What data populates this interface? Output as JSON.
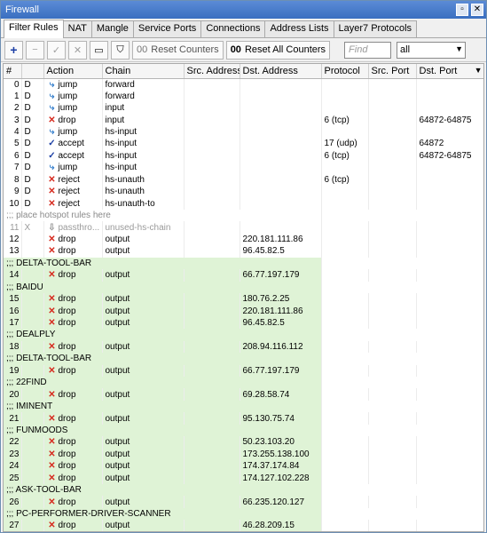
{
  "window": {
    "title": "Firewall"
  },
  "tabs": [
    "Filter Rules",
    "NAT",
    "Mangle",
    "Service Ports",
    "Connections",
    "Address Lists",
    "Layer7 Protocols"
  ],
  "toolbar": {
    "reset_counters": "Reset Counters",
    "reset_all_counters": "Reset All Counters",
    "find_placeholder": "Find",
    "filter_value": "all"
  },
  "columns": [
    "#",
    "",
    "Action",
    "Chain",
    "Src. Address",
    "Dst. Address",
    "Protocol",
    "Src. Port",
    "Dst. Port"
  ],
  "rows": [
    {
      "type": "rule",
      "n": "0",
      "f": "D",
      "a": "jump",
      "c": "forward",
      "src": "",
      "dst": "",
      "p": "",
      "sp": "",
      "dp": ""
    },
    {
      "type": "rule",
      "n": "1",
      "f": "D",
      "a": "jump",
      "c": "forward",
      "src": "",
      "dst": "",
      "p": "",
      "sp": "",
      "dp": ""
    },
    {
      "type": "rule",
      "n": "2",
      "f": "D",
      "a": "jump",
      "c": "input",
      "src": "",
      "dst": "",
      "p": "",
      "sp": "",
      "dp": ""
    },
    {
      "type": "rule",
      "n": "3",
      "f": "D",
      "a": "drop",
      "c": "input",
      "src": "",
      "dst": "",
      "p": "6 (tcp)",
      "sp": "",
      "dp": "64872-64875"
    },
    {
      "type": "rule",
      "n": "4",
      "f": "D",
      "a": "jump",
      "c": "hs-input",
      "src": "",
      "dst": "",
      "p": "",
      "sp": "",
      "dp": ""
    },
    {
      "type": "rule",
      "n": "5",
      "f": "D",
      "a": "accept",
      "c": "hs-input",
      "src": "",
      "dst": "",
      "p": "17 (udp)",
      "sp": "",
      "dp": "64872"
    },
    {
      "type": "rule",
      "n": "6",
      "f": "D",
      "a": "accept",
      "c": "hs-input",
      "src": "",
      "dst": "",
      "p": "6 (tcp)",
      "sp": "",
      "dp": "64872-64875"
    },
    {
      "type": "rule",
      "n": "7",
      "f": "D",
      "a": "jump",
      "c": "hs-input",
      "src": "",
      "dst": "",
      "p": "",
      "sp": "",
      "dp": ""
    },
    {
      "type": "rule",
      "n": "8",
      "f": "D",
      "a": "reject",
      "c": "hs-unauth",
      "src": "",
      "dst": "",
      "p": "6 (tcp)",
      "sp": "",
      "dp": ""
    },
    {
      "type": "rule",
      "n": "9",
      "f": "D",
      "a": "reject",
      "c": "hs-unauth",
      "src": "",
      "dst": "",
      "p": "",
      "sp": "",
      "dp": ""
    },
    {
      "type": "rule",
      "n": "10",
      "f": "D",
      "a": "reject",
      "c": "hs-unauth-to",
      "src": "",
      "dst": "",
      "p": "",
      "sp": "",
      "dp": ""
    },
    {
      "type": "hscomment",
      "text": ";;; place hotspot rules here"
    },
    {
      "type": "disabled",
      "n": "11",
      "f": "X",
      "a": "passthro...",
      "c": "unused-hs-chain",
      "src": "",
      "dst": "",
      "p": "",
      "sp": "",
      "dp": ""
    },
    {
      "type": "rule",
      "n": "12",
      "f": "",
      "a": "drop",
      "c": "output",
      "src": "",
      "dst": "220.181.111.86",
      "p": "",
      "sp": "",
      "dp": ""
    },
    {
      "type": "rule",
      "n": "13",
      "f": "",
      "a": "drop",
      "c": "output",
      "src": "",
      "dst": "96.45.82.5",
      "p": "",
      "sp": "",
      "dp": ""
    },
    {
      "type": "comment",
      "text": ";;; DELTA-TOOL-BAR"
    },
    {
      "type": "grule",
      "n": "14",
      "a": "drop",
      "c": "output",
      "dst": "66.77.197.179"
    },
    {
      "type": "comment",
      "text": ";;; BAIDU"
    },
    {
      "type": "grule",
      "n": "15",
      "a": "drop",
      "c": "output",
      "dst": "180.76.2.25"
    },
    {
      "type": "grule",
      "n": "16",
      "a": "drop",
      "c": "output",
      "dst": "220.181.111.86"
    },
    {
      "type": "grule",
      "n": "17",
      "a": "drop",
      "c": "output",
      "dst": "96.45.82.5"
    },
    {
      "type": "comment",
      "text": ";;; DEALPLY"
    },
    {
      "type": "grule",
      "n": "18",
      "a": "drop",
      "c": "output",
      "dst": "208.94.116.112"
    },
    {
      "type": "comment",
      "text": ";;; DELTA-TOOL-BAR"
    },
    {
      "type": "grule",
      "n": "19",
      "a": "drop",
      "c": "output",
      "dst": "66.77.197.179"
    },
    {
      "type": "comment",
      "text": ";;; 22FIND"
    },
    {
      "type": "grule",
      "n": "20",
      "a": "drop",
      "c": "output",
      "dst": "69.28.58.74"
    },
    {
      "type": "comment",
      "text": ";;; IMINENT"
    },
    {
      "type": "grule",
      "n": "21",
      "a": "drop",
      "c": "output",
      "dst": "95.130.75.74"
    },
    {
      "type": "comment",
      "text": ";;; FUNMOODS"
    },
    {
      "type": "grule",
      "n": "22",
      "a": "drop",
      "c": "output",
      "dst": "50.23.103.20"
    },
    {
      "type": "grule",
      "n": "23",
      "a": "drop",
      "c": "output",
      "dst": "173.255.138.100"
    },
    {
      "type": "grule",
      "n": "24",
      "a": "drop",
      "c": "output",
      "dst": "174.37.174.84"
    },
    {
      "type": "grule",
      "n": "25",
      "a": "drop",
      "c": "output",
      "dst": "174.127.102.228"
    },
    {
      "type": "comment",
      "text": ";;; ASK-TOOL-BAR"
    },
    {
      "type": "grule",
      "n": "26",
      "a": "drop",
      "c": "output",
      "dst": "66.235.120.127"
    },
    {
      "type": "comment",
      "text": ";;; PC-PERFORMER-DRIVER-SCANNER"
    },
    {
      "type": "grule",
      "n": "27",
      "a": "drop",
      "c": "output",
      "dst": "46.28.209.15"
    }
  ]
}
